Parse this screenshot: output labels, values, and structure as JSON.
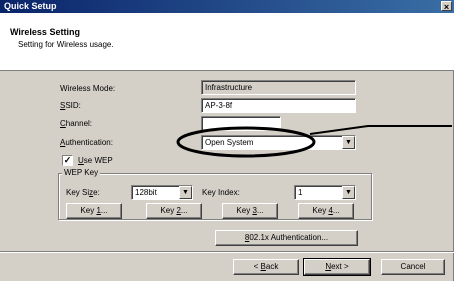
{
  "window": {
    "title": "Quick Setup",
    "close_glyph": "×"
  },
  "header": {
    "title": "Wireless Setting",
    "subtitle": "Setting for Wireless usage."
  },
  "form": {
    "wireless_mode": {
      "label": "Wireless Mode:",
      "value": "Infrastructure"
    },
    "ssid": {
      "label_u": "S",
      "label_rest": "SID:",
      "value": "AP-3-8f"
    },
    "channel": {
      "label_u": "C",
      "label_rest": "hannel:",
      "value": ""
    },
    "authentication": {
      "label_u": "A",
      "label_rest": "uthentication:",
      "value": "Open System"
    },
    "use_wep": {
      "label_u": "U",
      "label_rest": "se WEP",
      "checked_glyph": "✓"
    }
  },
  "wep": {
    "group_title": "WEP Key",
    "key_size": {
      "label_pre": "Key Si",
      "label_u": "z",
      "label_rest": "e:",
      "value": "128bit"
    },
    "key_index": {
      "label": "Key Index:",
      "value": "1"
    },
    "keys": [
      {
        "pre": "Key ",
        "u": "1",
        "post": "..."
      },
      {
        "pre": "Key ",
        "u": "2",
        "post": "..."
      },
      {
        "pre": "Key ",
        "u": "3",
        "post": "..."
      },
      {
        "pre": "Key ",
        "u": "4",
        "post": "..."
      }
    ]
  },
  "auth_8021x": {
    "u": "8",
    "rest": "02.1x Authentication..."
  },
  "footer": {
    "back": {
      "pre": "< ",
      "u": "B",
      "rest": "ack"
    },
    "next": {
      "u": "N",
      "rest": "ext >"
    },
    "cancel": "Cancel"
  },
  "icons": {
    "dropdown": "▼"
  },
  "colors": {
    "titlebar": "#0a246a",
    "face": "#d4d0c8"
  }
}
